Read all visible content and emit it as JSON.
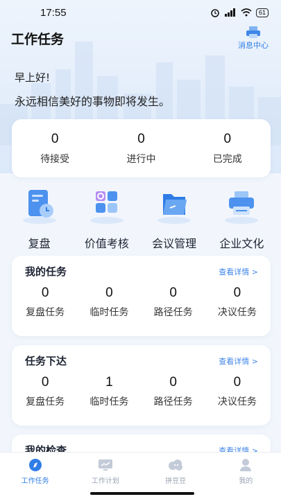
{
  "status_bar": {
    "time": "17:55",
    "battery": "61"
  },
  "header": {
    "title": "工作任务",
    "message_center": "消息中心"
  },
  "greeting": "早上好!",
  "motto": "永远相信美好的事物即将发生。",
  "summary": [
    {
      "value": "0",
      "label": "待接受"
    },
    {
      "value": "0",
      "label": "进行中"
    },
    {
      "value": "0",
      "label": "已完成"
    }
  ],
  "quick_actions": [
    {
      "label": "复盘",
      "icon": "review-calendar-icon"
    },
    {
      "label": "价值考核",
      "icon": "value-assessment-icon"
    },
    {
      "label": "会议管理",
      "icon": "meeting-folder-icon"
    },
    {
      "label": "企业文化",
      "icon": "printer-culture-icon"
    }
  ],
  "sections": [
    {
      "title": "我的任务",
      "link": "查看详情 >",
      "items": [
        {
          "value": "0",
          "label": "复盘任务"
        },
        {
          "value": "0",
          "label": "临时任务"
        },
        {
          "value": "0",
          "label": "路径任务"
        },
        {
          "value": "0",
          "label": "决议任务"
        }
      ]
    },
    {
      "title": "任务下达",
      "link": "查看详情 >",
      "items": [
        {
          "value": "0",
          "label": "复盘任务"
        },
        {
          "value": "1",
          "label": "临时任务"
        },
        {
          "value": "0",
          "label": "路径任务"
        },
        {
          "value": "0",
          "label": "决议任务"
        }
      ]
    },
    {
      "title": "我的检查",
      "link": "查看详情 >"
    }
  ],
  "tabs": [
    {
      "label": "工作任务",
      "active": true,
      "icon": "compass-icon"
    },
    {
      "label": "工作计划",
      "active": false,
      "icon": "monitor-icon"
    },
    {
      "label": "拼豆豆",
      "active": false,
      "icon": "cloud-chat-icon"
    },
    {
      "label": "我的",
      "active": false,
      "icon": "person-icon"
    }
  ],
  "colors": {
    "accent": "#2f7de6",
    "background": "#f2f6fc"
  }
}
